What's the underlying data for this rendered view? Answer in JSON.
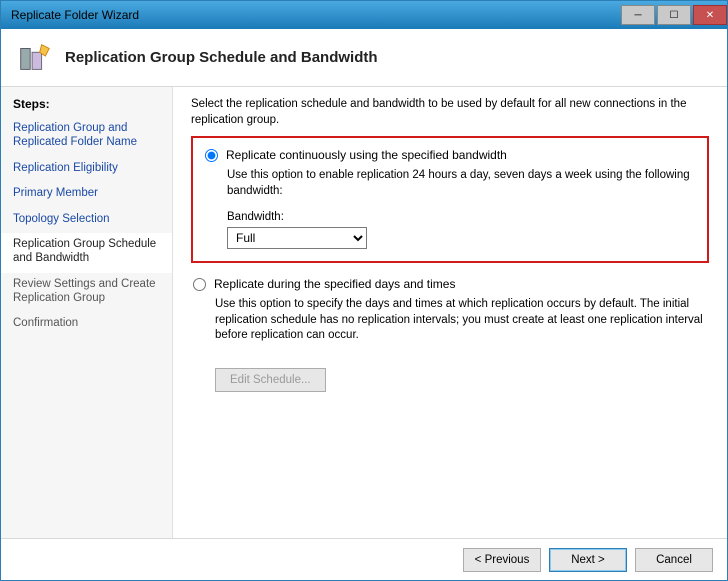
{
  "window": {
    "title": "Replicate Folder Wizard"
  },
  "header": {
    "title": "Replication Group Schedule and Bandwidth"
  },
  "sidebar": {
    "heading": "Steps:",
    "items": [
      {
        "label": "Replication Group and Replicated Folder Name",
        "state": "done"
      },
      {
        "label": "Replication Eligibility",
        "state": "done"
      },
      {
        "label": "Primary Member",
        "state": "done"
      },
      {
        "label": "Topology Selection",
        "state": "done"
      },
      {
        "label": "Replication Group Schedule and Bandwidth",
        "state": "current"
      },
      {
        "label": "Review Settings and Create Replication Group",
        "state": "future"
      },
      {
        "label": "Confirmation",
        "state": "future"
      }
    ]
  },
  "main": {
    "instruction": "Select the replication schedule and bandwidth to be used by default for all new connections in the replication group.",
    "option1": {
      "label": "Replicate continuously using the specified bandwidth",
      "desc": "Use this option to enable replication 24 hours a day, seven days a week using the following bandwidth:",
      "bandwidth_label": "Bandwidth:",
      "bandwidth_value": "Full"
    },
    "option2": {
      "label": "Replicate during the specified days and times",
      "desc": "Use this option to specify the days and times at which replication occurs by default. The initial replication schedule has no replication intervals; you must create at least one replication interval before replication can occur.",
      "edit_button": "Edit Schedule..."
    }
  },
  "footer": {
    "previous": "< Previous",
    "next": "Next >",
    "cancel": "Cancel"
  }
}
